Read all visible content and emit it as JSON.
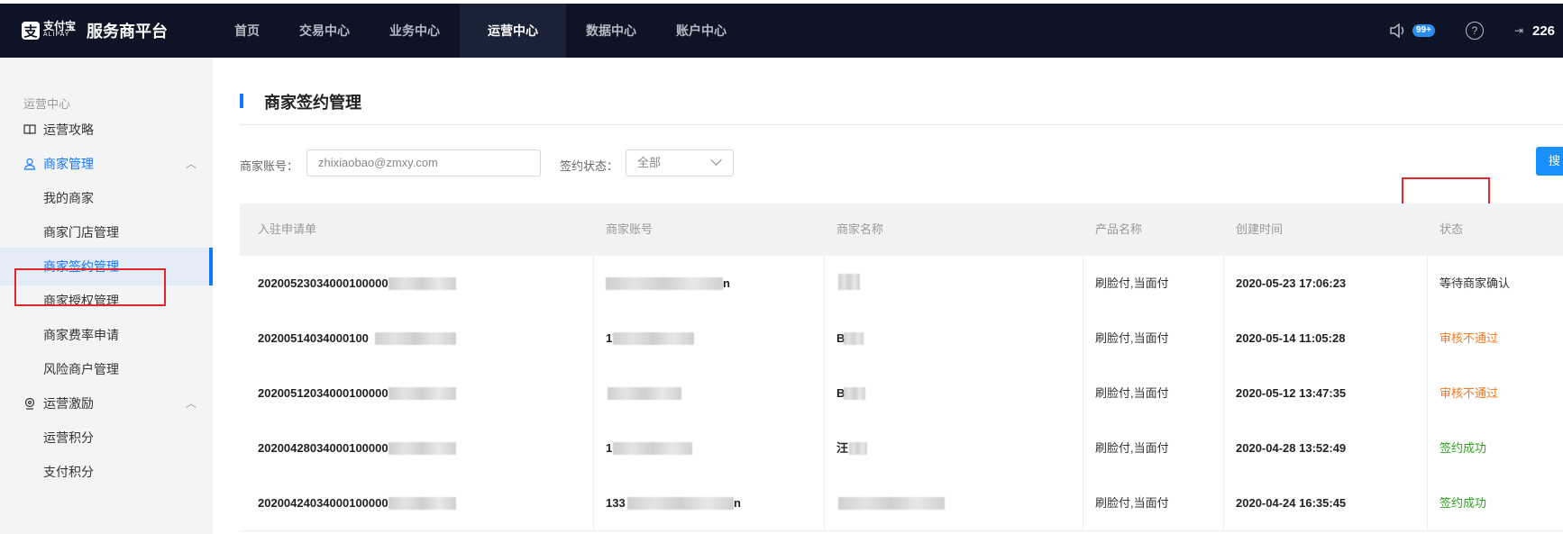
{
  "app": {
    "logo_cn": "支付宝",
    "logo_en": "ALIPAY",
    "title": "服务商平台"
  },
  "nav": {
    "items": [
      "首页",
      "交易中心",
      "业务中心",
      "运营中心",
      "数据中心",
      "账户中心"
    ],
    "active_index": 3
  },
  "top_right": {
    "notification_badge": "99+",
    "help_symbol": "?",
    "user_partial": "226"
  },
  "sidebar": {
    "section_title": "运营中心",
    "items": [
      {
        "label": "运营攻略",
        "icon": "book-icon"
      },
      {
        "label": "商家管理",
        "icon": "user-icon",
        "expanded": true
      },
      {
        "label": "我的商家"
      },
      {
        "label": "商家门店管理"
      },
      {
        "label": "商家签约管理",
        "active": true
      },
      {
        "label": "商家授权管理"
      },
      {
        "label": "商家费率申请"
      },
      {
        "label": "风险商户管理"
      },
      {
        "label": "运营激励",
        "icon": "gift-icon",
        "expanded": true
      },
      {
        "label": "运营积分"
      },
      {
        "label": "支付积分"
      }
    ]
  },
  "page": {
    "title": "商家签约管理"
  },
  "filters": {
    "account_label": "商家账号：",
    "account_value": "zhixiaobao@zmxy.com",
    "status_label": "签约状态：",
    "status_value": "全部",
    "search_label": "搜"
  },
  "table": {
    "columns": [
      "入驻申请单",
      "商家账号",
      "商家名称",
      "产品名称",
      "创建时间",
      "状态"
    ],
    "rows": [
      {
        "order": "20200523034000100000",
        "account": "",
        "account_suffix": "n",
        "name": "",
        "product": "刷脸付,当面付",
        "created": "2020-05-23 17:06:23",
        "status": "等待商家确认",
        "status_color": "#333333"
      },
      {
        "order": "20200514034000100",
        "account": "1",
        "account_suffix": "",
        "name": "B",
        "product": "刷脸付,当面付",
        "created": "2020-05-14 11:05:28",
        "status": "审核不通过",
        "status_color": "#f5781e"
      },
      {
        "order": "20200512034000100000",
        "account": "",
        "account_suffix": "",
        "name": "B",
        "product": "刷脸付,当面付",
        "created": "2020-05-12 13:47:35",
        "status": "审核不通过",
        "status_color": "#f5781e"
      },
      {
        "order": "20200428034000100000",
        "account": "1",
        "account_suffix": "",
        "name": "汪",
        "product": "刷脸付,当面付",
        "created": "2020-04-28 13:52:49",
        "status": "签约成功",
        "status_color": "#2ea121"
      },
      {
        "order": "20200424034000100000",
        "account": "133",
        "account_suffix": "n",
        "name": "",
        "product": "刷脸付,当面付",
        "created": "2020-04-24 16:35:45",
        "status": "签约成功",
        "status_color": "#2ea121"
      }
    ]
  },
  "colors": {
    "nav_bg": "#0e1425",
    "accent": "#1677ff",
    "highlight": "#e4262c"
  }
}
